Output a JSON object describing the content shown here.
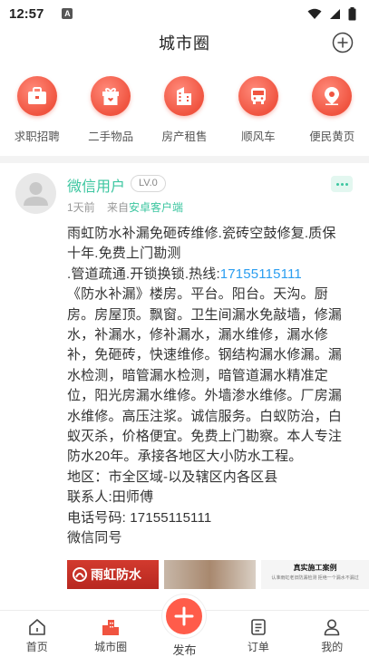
{
  "status_bar": {
    "time": "12:57",
    "notification_letter": "A"
  },
  "header": {
    "title": "城市圈"
  },
  "categories": [
    {
      "label": "求职招聘",
      "icon": "briefcase-icon"
    },
    {
      "label": "二手物品",
      "icon": "gift-box-icon"
    },
    {
      "label": "房产租售",
      "icon": "building-icon"
    },
    {
      "label": "顺风车",
      "icon": "bus-icon"
    },
    {
      "label": "便民黄页",
      "icon": "location-pin-icon"
    }
  ],
  "post": {
    "user_name": "微信用户",
    "level": "LV.0",
    "time_ago": "1天前",
    "from_prefix": "来自",
    "source": "安卓客户端",
    "content_lines": {
      "l1": "雨虹防水补漏免砸砖维修.瓷砖空鼓修复.质保十年.免费上门勘测",
      "l2_prefix": ".管道疏通.开锁换锁.热线:",
      "phone": "17155115111",
      "l3": "《防水补漏》楼房。平台。阳台。天沟。厨房。房屋顶。飘窗。卫生间漏水免敲墙，修漏水，补漏水，修补漏水，漏水维修，漏水修补，免砸砖，快速维修。钢结构漏水修漏。漏水检测，暗管漏水检测，暗管道漏水精准定位，阳光房漏水维修。外墙渗水维修。厂房漏水维修。高压注浆。诚信服务。白蚁防治，白蚁灭杀，价格便宜。免费上门勘察。本人专注防水20年。承接各地区大小防水工程。",
      "l4": "地区：市全区域-以及辖区内各区县",
      "l5": "联系人:田师傅",
      "l6": "电话号码: 17155115111",
      "l7": "微信同号"
    },
    "images": {
      "thumb1_text": "雨虹防水",
      "thumb3_title": "真实施工案例",
      "thumb3_sub": "认准雨虹老旧防漏检测 拒绝一个漏水不漏过"
    }
  },
  "tabs": [
    {
      "label": "首页",
      "icon": "home-icon"
    },
    {
      "label": "城市圈",
      "icon": "city-buildings-icon"
    },
    {
      "label": "发布",
      "icon": "plus-icon"
    },
    {
      "label": "订单",
      "icon": "order-list-icon"
    },
    {
      "label": "我的",
      "icon": "person-icon"
    }
  ],
  "colors": {
    "accent_green": "#3cc6a0",
    "accent_red": "#f05440",
    "link_blue": "#2b9ef0"
  }
}
